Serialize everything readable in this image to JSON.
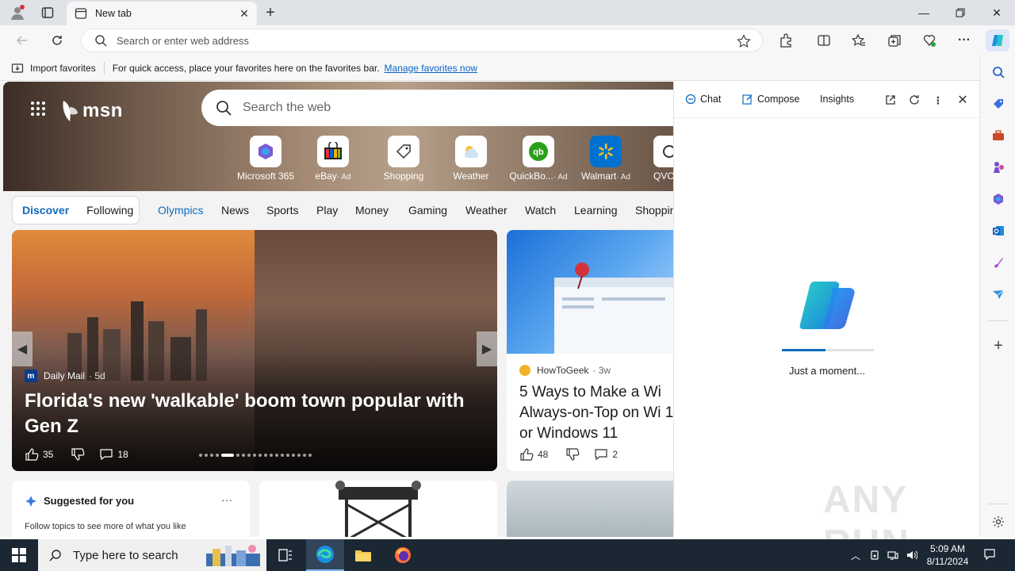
{
  "browser": {
    "tab_title": "New tab",
    "address_placeholder": "Search or enter web address",
    "favorites_bar": {
      "import_label": "Import favorites",
      "hint": "For quick access, place your favorites here on the favorites bar.",
      "manage_link": "Manage favorites now"
    }
  },
  "msn": {
    "logo": "msn",
    "search_placeholder": "Search the web",
    "tiles": [
      {
        "label": "Microsoft 365",
        "ad": ""
      },
      {
        "label": "eBay",
        "ad": "· Ad"
      },
      {
        "label": "Shopping",
        "ad": ""
      },
      {
        "label": "Weather",
        "ad": ""
      },
      {
        "label": "QuickBo...",
        "ad": "· Ad"
      },
      {
        "label": "Walmart",
        "ad": "· Ad"
      },
      {
        "label": "QVC",
        "ad": ""
      }
    ],
    "feed_tabs": {
      "discover": "Discover",
      "following": "Following"
    },
    "nav": [
      "Olympics",
      "News",
      "Sports",
      "Play",
      "Money",
      "Gaming",
      "Weather",
      "Watch",
      "Learning",
      "Shoppin"
    ],
    "main_story": {
      "source": "Daily Mail",
      "age": "· 5d",
      "headline": "Florida's new 'walkable' boom town popular with Gen Z",
      "likes": "35",
      "comments": "18"
    },
    "side_story": {
      "source": "HowToGeek",
      "age": "· 3w",
      "headline": "5 Ways to Make a Wi Always-on-Top on Wi 10 or Windows 11",
      "likes": "48",
      "comments": "2"
    },
    "suggested": {
      "title": "Suggested for you",
      "description": "Follow topics to see more of what you like",
      "more": "···"
    }
  },
  "copilot": {
    "tabs": {
      "chat": "Chat",
      "compose": "Compose",
      "insights": "Insights"
    },
    "loading_text": "Just a moment...",
    "loading_progress": 0.47,
    "watermark": "ANY RUN"
  },
  "taskbar": {
    "search_placeholder": "Type here to search",
    "time": "5:09 AM",
    "date": "8/11/2024"
  },
  "colors": {
    "accent": "#0f6cbd",
    "taskbar": "#1c2734"
  }
}
